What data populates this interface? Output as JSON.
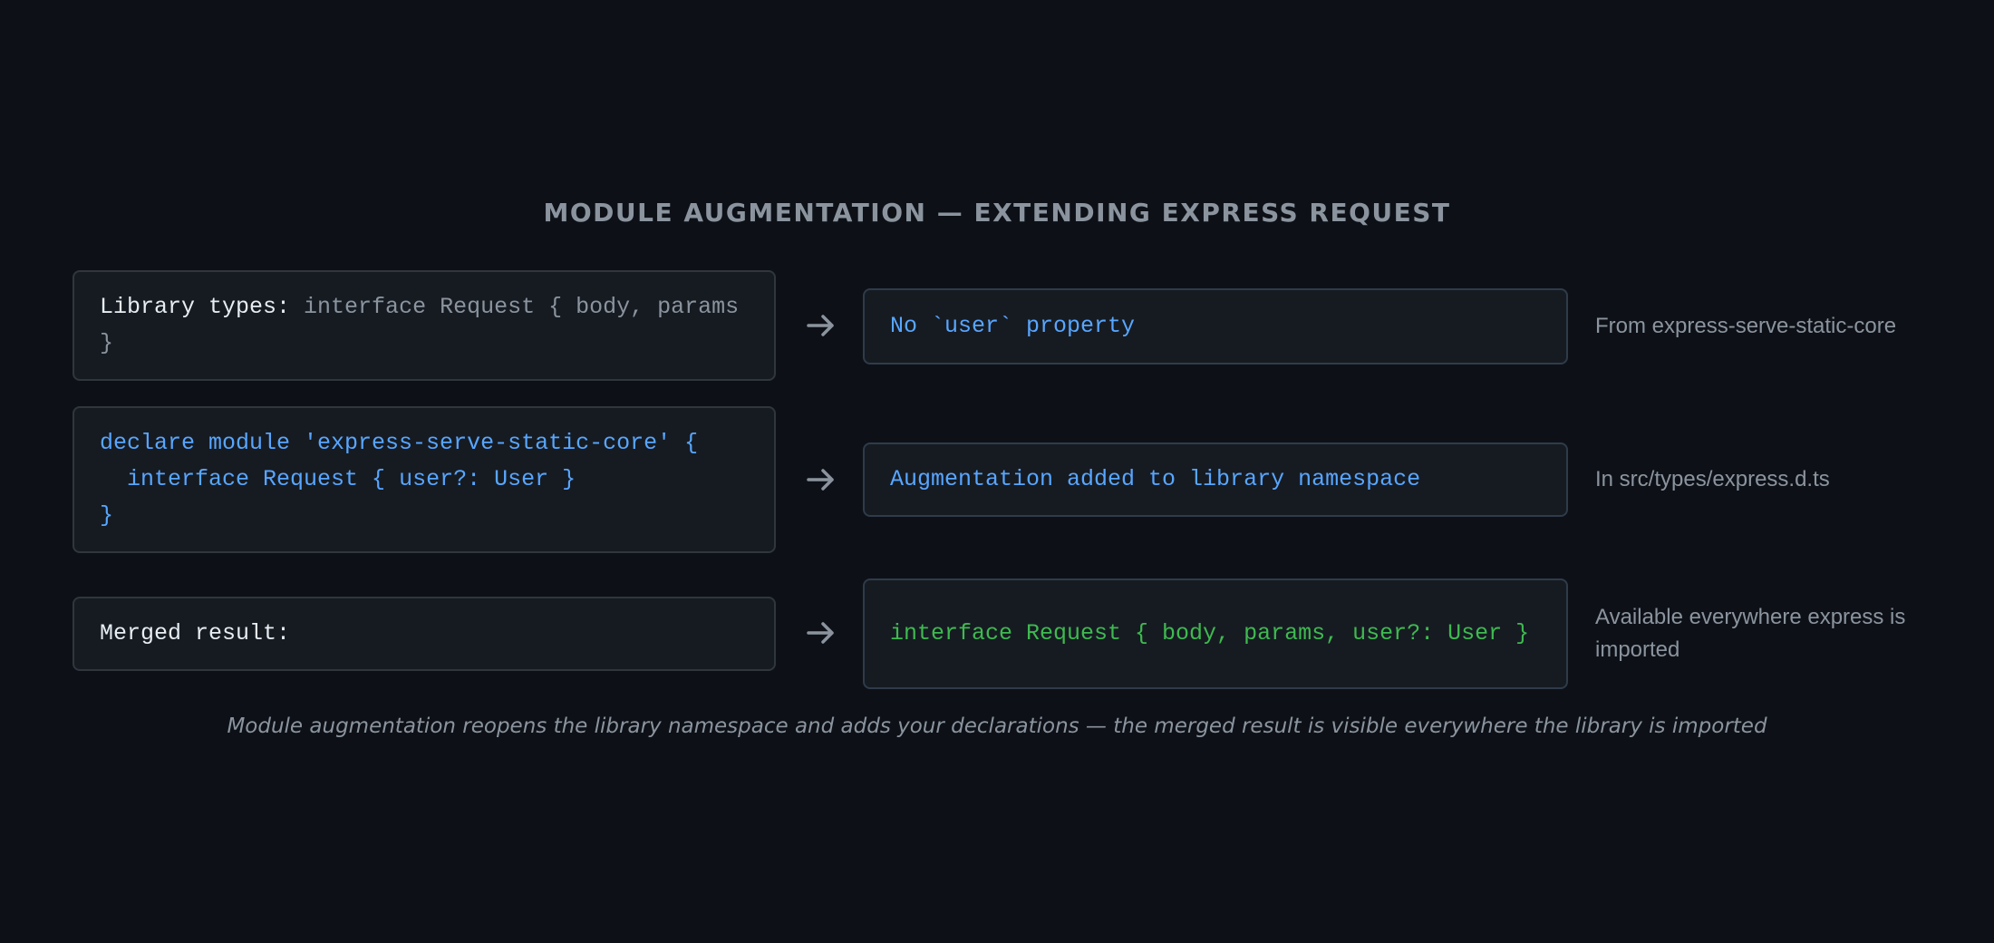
{
  "title": "MODULE AUGMENTATION — EXTENDING EXPRESS REQUEST",
  "rows": [
    {
      "left_label": "Library types: ",
      "left_code": "interface Request { body, params }",
      "right_text": "No `user` property",
      "note": "From express-serve-static-core"
    },
    {
      "left_code": "declare module 'express-serve-static-core' {\n  interface Request { user?: User }\n}",
      "right_text": "Augmentation added to library namespace",
      "note": "In src/types/express.d.ts"
    },
    {
      "left_label": "Merged result:",
      "right_text": "interface Request { body, params, user?: User }",
      "note": "Available everywhere express is imported"
    }
  ],
  "caption": "Module augmentation reopens the library namespace and adds your declarations — the merged result is visible everywhere the library is imported",
  "colors": {
    "background": "#0d1117",
    "box_fill": "#161b22",
    "box_border": "#30363d",
    "code_blue": "#58a6ff",
    "code_green": "#3fb950",
    "muted_text": "#8b949e",
    "label_text": "#e6edf3"
  },
  "icons": {
    "arrow": "arrow-right-icon"
  }
}
